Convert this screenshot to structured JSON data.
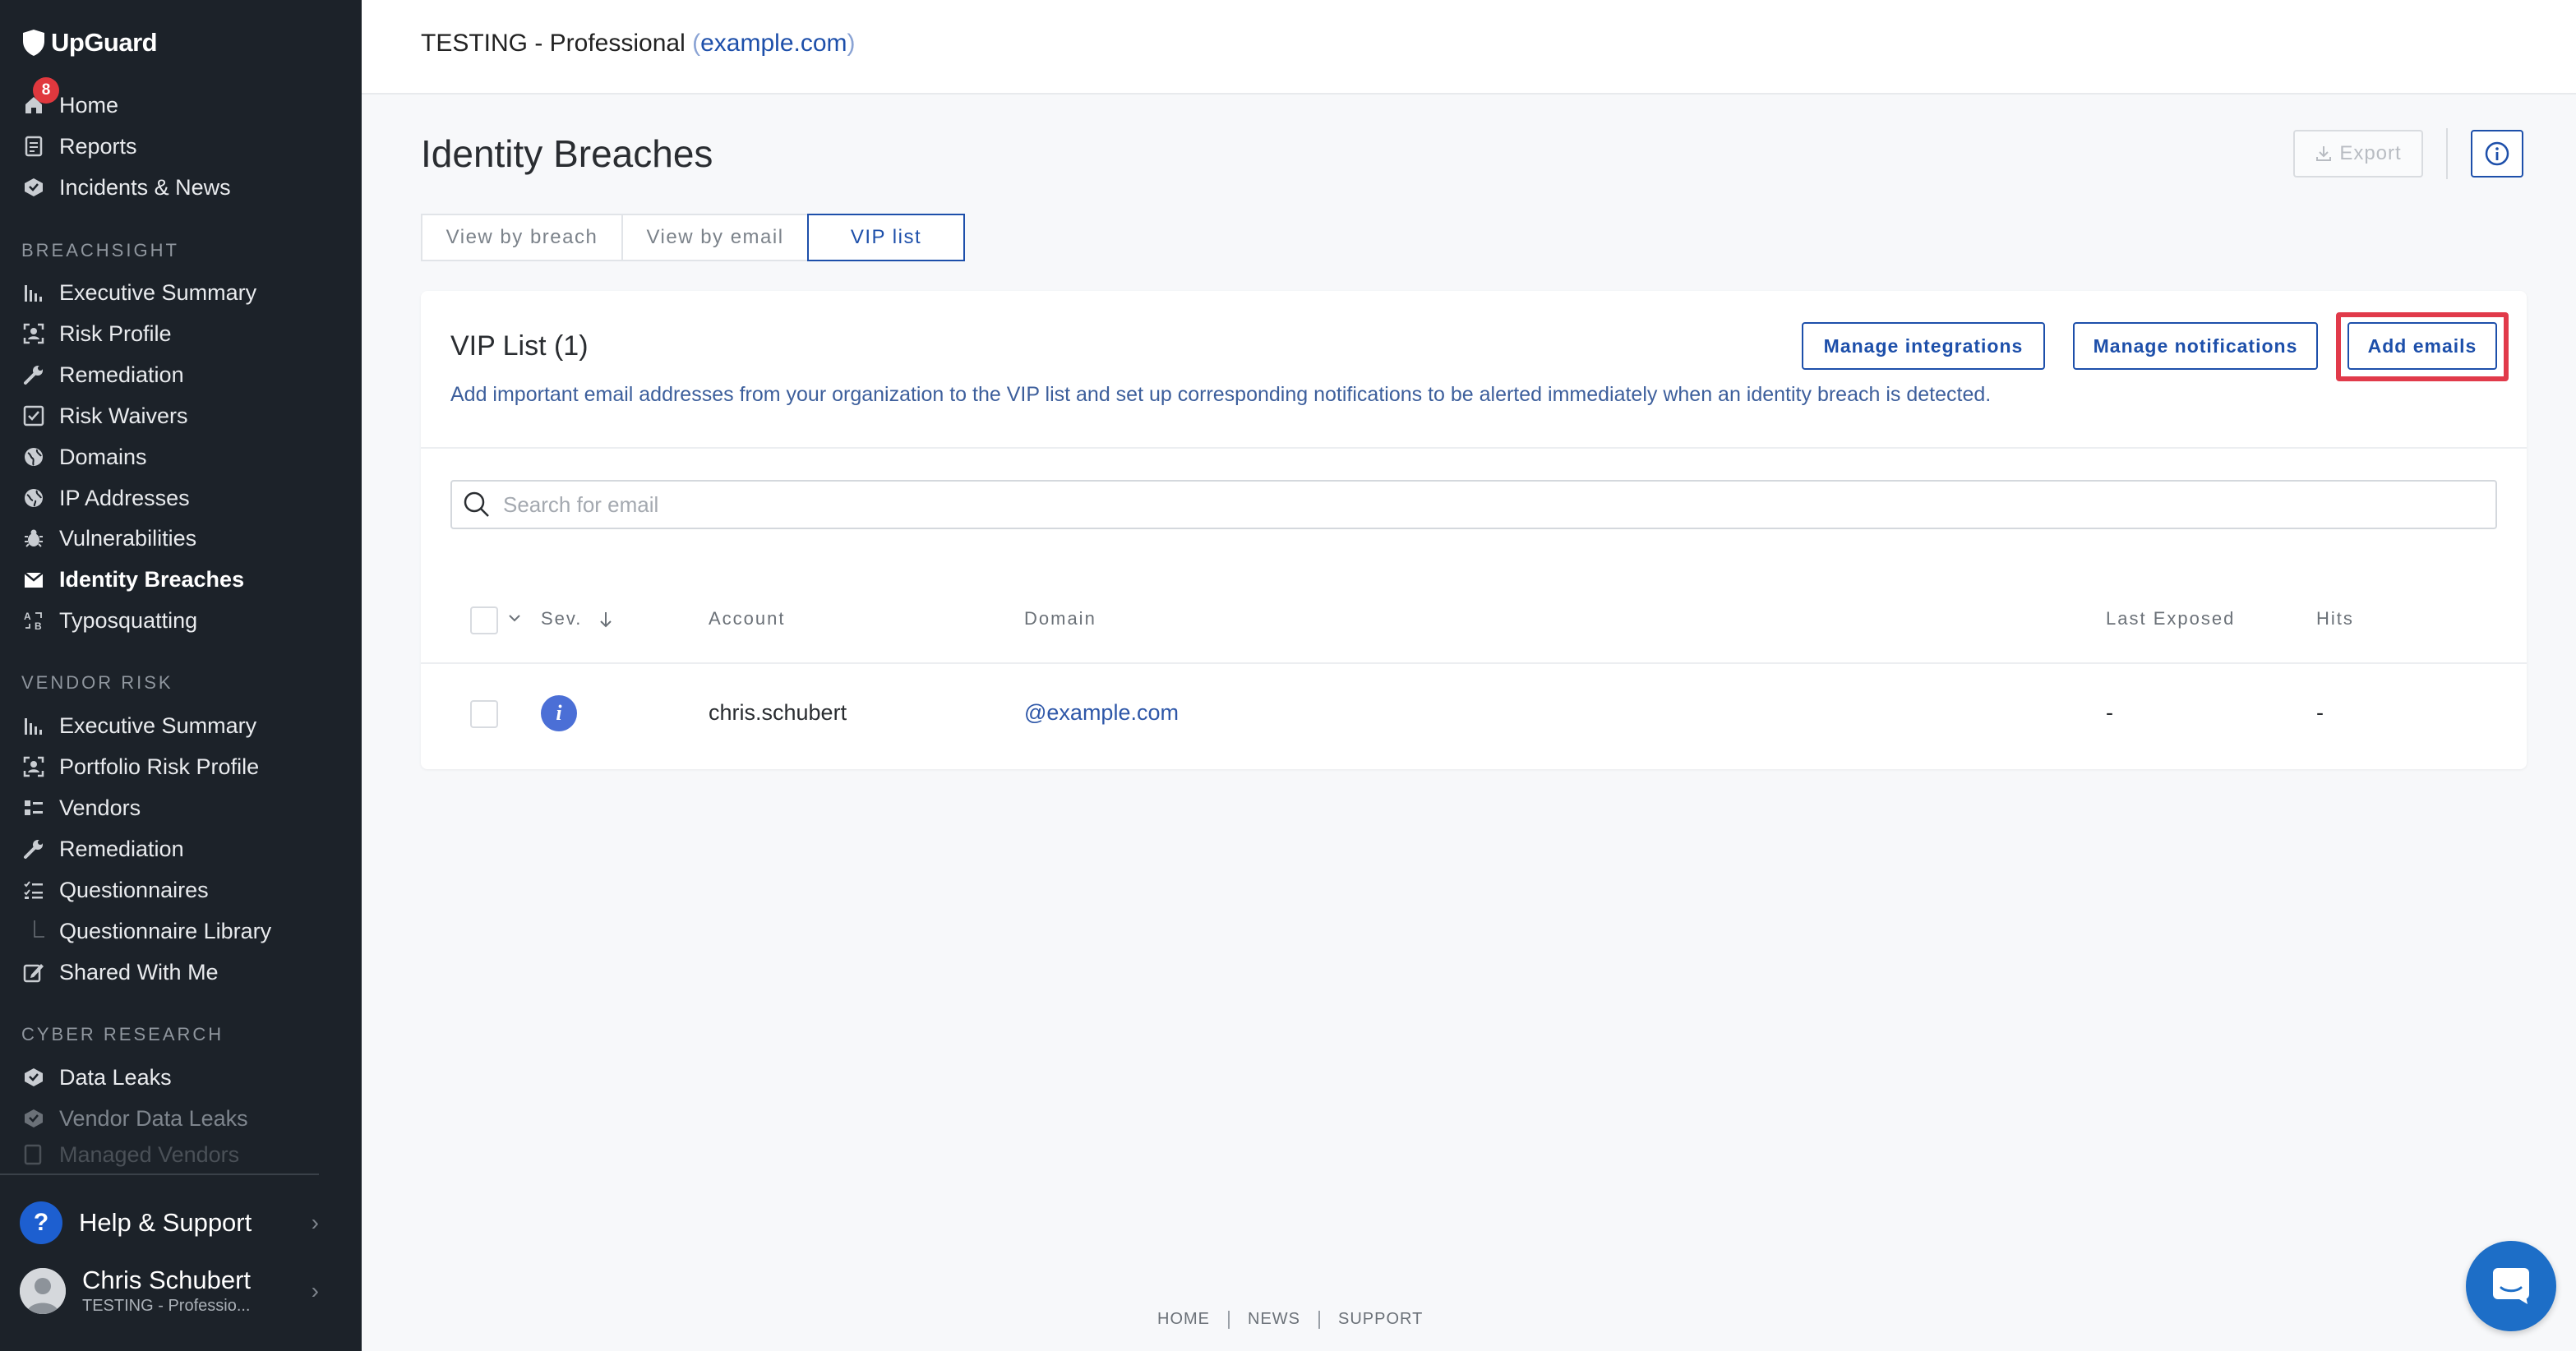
{
  "sidebar": {
    "brand": "UpGuard",
    "home_badge": "8",
    "top_items": [
      {
        "label": "Home",
        "icon": "home-icon"
      },
      {
        "label": "Reports",
        "icon": "reports-icon"
      },
      {
        "label": "Incidents & News",
        "icon": "incidents-icon"
      }
    ],
    "breachsight_header": "BREACHSIGHT",
    "breachsight_items": [
      {
        "label": "Executive Summary"
      },
      {
        "label": "Risk Profile"
      },
      {
        "label": "Remediation"
      },
      {
        "label": "Risk Waivers"
      },
      {
        "label": "Domains"
      },
      {
        "label": "IP Addresses"
      },
      {
        "label": "Vulnerabilities"
      },
      {
        "label": "Identity Breaches"
      },
      {
        "label": "Typosquatting"
      }
    ],
    "vendor_header": "VENDOR RISK",
    "vendor_items": [
      {
        "label": "Executive Summary"
      },
      {
        "label": "Portfolio Risk Profile"
      },
      {
        "label": "Vendors"
      },
      {
        "label": "Remediation"
      },
      {
        "label": "Questionnaires"
      },
      {
        "label": "Questionnaire Library"
      },
      {
        "label": "Shared With Me"
      }
    ],
    "cyber_header": "CYBER RESEARCH",
    "cyber_items": [
      {
        "label": "Data Leaks"
      },
      {
        "label": "Vendor Data Leaks"
      },
      {
        "label": "Managed Vendors"
      }
    ],
    "help_label": "Help & Support",
    "user_name": "Chris Schubert",
    "user_org": "TESTING - Professio..."
  },
  "topbar": {
    "org": "TESTING - Professional",
    "paren_open": "(",
    "domain": "example.com",
    "paren_close": ")"
  },
  "page": {
    "title": "Identity Breaches",
    "export_label": "Export"
  },
  "tabs": [
    {
      "label": "View by breach"
    },
    {
      "label": "View by email"
    },
    {
      "label": "VIP list"
    }
  ],
  "card": {
    "title": "VIP List (1)",
    "description": "Add important email addresses from your organization to the VIP list and set up corresponding notifications to be alerted immediately when an identity breach is detected.",
    "btn_integrations": "Manage integrations",
    "btn_notifications": "Manage notifications",
    "btn_add": "Add emails",
    "search_placeholder": "Search for email"
  },
  "table": {
    "headers": {
      "sev": "Sev.",
      "account": "Account",
      "domain": "Domain",
      "last_exposed": "Last Exposed",
      "hits": "Hits"
    },
    "rows": [
      {
        "sev": "i",
        "account": "chris.schubert",
        "domain": "@example.com",
        "last_exposed": "-",
        "hits": "-"
      }
    ]
  },
  "footer": {
    "home": "HOME",
    "news": "NEWS",
    "support": "SUPPORT"
  },
  "colors": {
    "accent": "#1d4faa",
    "sidebar_bg": "#1c2229",
    "highlight": "#e13a4a",
    "badge": "#e0383e"
  }
}
